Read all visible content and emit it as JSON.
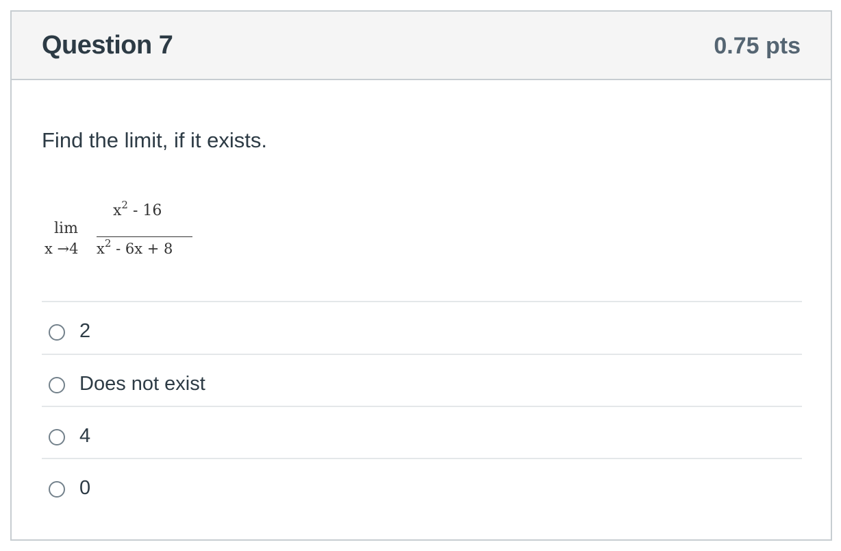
{
  "question": {
    "title": "Question 7",
    "points": "0.75 pts",
    "prompt": "Find the limit, if it exists.",
    "math": {
      "lim": "lim",
      "approach": "x →4",
      "numerator_base": "x",
      "numerator_exp": "2",
      "numerator_rest": " - 16",
      "denominator_base": "x",
      "denominator_exp": "2",
      "denominator_rest": " - 6x + 8"
    },
    "answers": [
      {
        "label": "2",
        "selected": false
      },
      {
        "label": "Does not exist",
        "selected": false
      },
      {
        "label": "4",
        "selected": false
      },
      {
        "label": "0",
        "selected": false
      }
    ]
  },
  "colors": {
    "header_bg": "#f5f5f5",
    "border": "#c7cdd1",
    "text": "#2d3b45",
    "points_text": "#556572",
    "divider": "#e4e7e9"
  }
}
